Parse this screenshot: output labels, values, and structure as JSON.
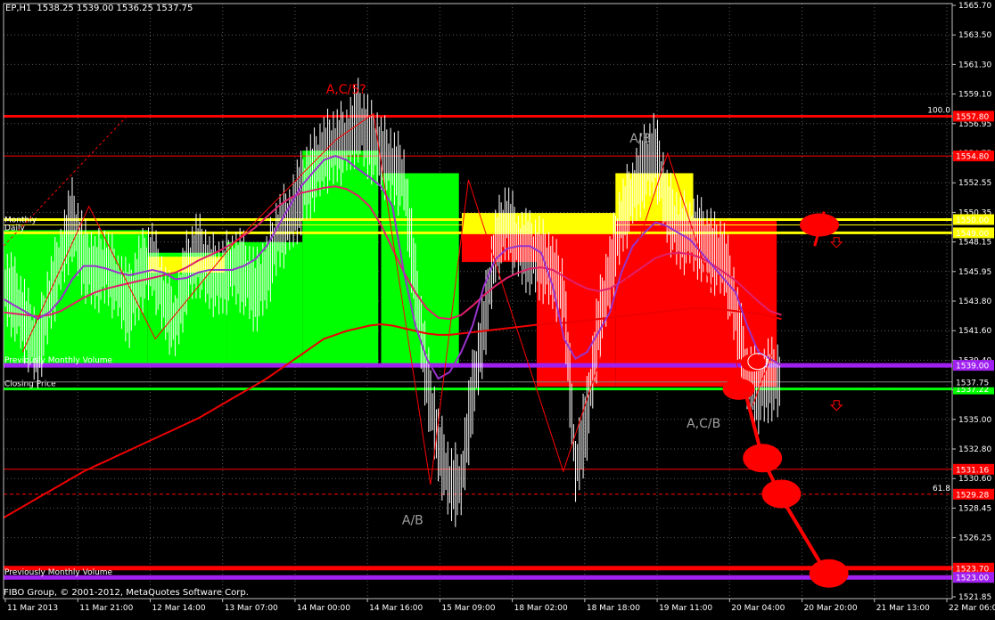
{
  "header": {
    "symbol": "EP,H1",
    "ohlc": "1538.25 1539.00 1536.25 1537.75"
  },
  "footer": {
    "copyright": "FIBO Group, © 2001-2012, MetaQuotes Software Corp."
  },
  "colors": {
    "background": "#000000",
    "frame": "#c0c0c0",
    "grid": "#c8c8c8",
    "green_box": "#00ff00",
    "red_box": "#ff0000",
    "yellow_box": "#ffff00",
    "ma_fast": "#9933cc",
    "ma_mid": "#e0206a",
    "ma_slow": "#ee0000",
    "pattern": "#ff0000"
  },
  "chart_data": {
    "type": "candlestick",
    "y_ticks": [
      "1565.70",
      "1563.50",
      "1561.30",
      "1559.10",
      "1556.95",
      "1554.75",
      "1552.55",
      "1550.35",
      "1548.15",
      "1545.95",
      "1543.80",
      "1541.60",
      "1539.40",
      "1537.20",
      "1535.00",
      "1532.80",
      "1530.60",
      "1528.45",
      "1526.25",
      "1524.05",
      "1521.85"
    ],
    "x_ticks": [
      "11 Mar 2013",
      "11 Mar 21:00",
      "12 Mar 14:00",
      "13 Mar 07:00",
      "14 Mar 00:00",
      "14 Mar 16:00",
      "15 Mar 09:00",
      "18 Mar 02:00",
      "18 Mar 18:00",
      "19 Mar 11:00",
      "20 Mar 04:00",
      "20 Mar 20:00",
      "21 Mar 13:00",
      "22 Mar 06:00"
    ],
    "ylim": [
      1521.4,
      1566.3
    ],
    "grid": true,
    "levels": [
      {
        "name": "level-top",
        "price": 1557.8,
        "color": "#ff0000",
        "width": 3,
        "tag": "1557.80",
        "right_label": "100.0"
      },
      {
        "name": "level-1554",
        "price": 1554.8,
        "color": "#ff0000",
        "width": 1,
        "tag": "1554.80"
      },
      {
        "name": "level-1550",
        "price": 1550.0,
        "color": "#ffff00",
        "width": 3,
        "tag": "1550.00"
      },
      {
        "name": "level-monthly",
        "price": 1549.6,
        "color": "#ffff00",
        "width": 1,
        "tag": "",
        "left_label": "Monthly"
      },
      {
        "name": "level-daily",
        "price": 1549.0,
        "color": "#ffff00",
        "width": 3,
        "tag": "1549.00",
        "left_label": "Daily"
      },
      {
        "name": "level-prev-volume",
        "price": 1539.0,
        "color": "#a020f0",
        "width": 5,
        "tag": "1539.00",
        "left_label": "Previously Monthly Volume"
      },
      {
        "name": "level-close",
        "price": 1537.22,
        "color": "#00ff00",
        "width": 3,
        "tag": "1537.22",
        "left_label": "Closing Price"
      },
      {
        "name": "level-1531",
        "price": 1531.16,
        "color": "#ff0000",
        "width": 1,
        "tag": "1531.16"
      },
      {
        "name": "level-1529",
        "price": 1529.28,
        "color": "#ff0000",
        "width": 1,
        "tag": "1529.28",
        "right_label": "61.8",
        "dashed": true
      },
      {
        "name": "level-1523-red",
        "price": 1523.7,
        "color": "#ff0000",
        "width": 5,
        "tag": "1523.70"
      },
      {
        "name": "level-1523-purple",
        "price": 1523.0,
        "color": "#a020f0",
        "width": 5,
        "tag": "1523.00",
        "left_label": "Previously Monthly Volume"
      }
    ],
    "current_price": "1537.75",
    "boxes": [
      {
        "color": "#00ff00",
        "x0": 0,
        "x1": 0.152,
        "y0": 1549.2,
        "y1": 1539.0
      },
      {
        "color": "#00ff00",
        "x0": 0.152,
        "x1": 0.235,
        "y0": 1547.5,
        "y1": 1539.0
      },
      {
        "color": "#00ff00",
        "x0": 0.235,
        "x1": 0.315,
        "y0": 1548.3,
        "y1": 1539.0
      },
      {
        "color": "#00ff00",
        "x0": 0.315,
        "x1": 0.395,
        "y0": 1555.2,
        "y1": 1539.0
      },
      {
        "color": "#00ff00",
        "x0": 0.398,
        "x1": 0.48,
        "y0": 1553.5,
        "y1": 1539.0
      },
      {
        "color": "#ffff00",
        "x0": 0.152,
        "x1": 0.233,
        "y0": 1547.2,
        "y1": 1546.0
      },
      {
        "color": "#ffff00",
        "x0": 0.483,
        "x1": 0.562,
        "y0": 1550.5,
        "y1": 1549.0
      },
      {
        "color": "#ff0000",
        "x0": 0.483,
        "x1": 0.562,
        "y0": 1549.0,
        "y1": 1546.8
      },
      {
        "color": "#ffff00",
        "x0": 0.562,
        "x1": 0.645,
        "y0": 1550.5,
        "y1": 1549.0
      },
      {
        "color": "#ff0000",
        "x0": 0.562,
        "x1": 0.645,
        "y0": 1549.0,
        "y1": 1537.4
      },
      {
        "color": "#ff0000",
        "x0": 0.645,
        "x1": 0.727,
        "y0": 1550.0,
        "y1": 1537.4
      },
      {
        "color": "#ffff00",
        "x0": 0.645,
        "x1": 0.727,
        "y0": 1553.5,
        "y1": 1550.0
      },
      {
        "color": "#ff0000",
        "x0": 0.727,
        "x1": 0.815,
        "y0": 1550.0,
        "y1": 1537.4
      }
    ],
    "closes": [
      1545,
      1544,
      1542,
      1540,
      1544,
      1547,
      1550,
      1547,
      1546,
      1546.5,
      1545,
      1543.5,
      1546,
      1547,
      1544,
      1542,
      1546,
      1547.5,
      1546,
      1545.5,
      1546.5,
      1546,
      1544.5,
      1546,
      1549,
      1550,
      1552,
      1553.5,
      1555,
      1555.5,
      1556,
      1557.5,
      1556,
      1555,
      1554,
      1553,
      1545,
      1538,
      1533,
      1530,
      1530,
      1537,
      1542,
      1548,
      1550,
      1548,
      1547.5,
      1547,
      1546,
      1544,
      1531,
      1535,
      1542,
      1546,
      1550,
      1552,
      1554,
      1555,
      1551,
      1549,
      1549,
      1548.5,
      1547.5,
      1547,
      1543,
      1538,
      1537,
      1538,
      1537.75
    ],
    "ma_fast": [
      1544,
      1543.5,
      1543,
      1542.5,
      1543,
      1544,
      1545.5,
      1546.5,
      1546.5,
      1546.3,
      1546,
      1545.8,
      1546,
      1546.2,
      1546,
      1545.5,
      1545.6,
      1546,
      1546.2,
      1546.2,
      1546.2,
      1546.5,
      1547,
      1548,
      1549.5,
      1551,
      1552.5,
      1553.5,
      1554.5,
      1554.8,
      1554.5,
      1553.8,
      1553.2,
      1552.5,
      1551,
      1546,
      1542,
      1539.5,
      1538,
      1538.5,
      1540,
      1542,
      1545,
      1547,
      1547.8,
      1548,
      1548,
      1547.5,
      1545,
      1541,
      1539.5,
      1540,
      1541.5,
      1543,
      1546,
      1548,
      1549,
      1549.8,
      1549.5,
      1549,
      1548.5,
      1547.5,
      1546.5,
      1545.5,
      1544.5,
      1542,
      1540,
      1539.5,
      1539
    ],
    "ma_mid": [
      1543,
      1542.9,
      1542.8,
      1542.7,
      1542.8,
      1543.1,
      1543.6,
      1544.1,
      1544.5,
      1544.8,
      1545,
      1545.2,
      1545.4,
      1545.6,
      1545.8,
      1546,
      1546.4,
      1546.9,
      1547.3,
      1547.7,
      1548.2,
      1548.8,
      1549.4,
      1550.2,
      1551,
      1551.6,
      1552,
      1552.2,
      1552.4,
      1552.5,
      1552.3,
      1551.8,
      1551,
      1549.6,
      1547.8,
      1546,
      1544.5,
      1543.3,
      1542.6,
      1542.5,
      1542.8,
      1543.5,
      1544.3,
      1545,
      1545.6,
      1546,
      1546.3,
      1546.4,
      1546.2,
      1545.7,
      1545.2,
      1544.8,
      1544.6,
      1544.8,
      1545.3,
      1545.9,
      1546.5,
      1547.1,
      1547.4,
      1547.5,
      1547.4,
      1547.1,
      1546.6,
      1546,
      1545.4,
      1544.6,
      1543.8,
      1543.1,
      1542.8
    ],
    "ma_slow": [
      1527.5,
      1528,
      1528.5,
      1529,
      1529.5,
      1530,
      1530.5,
      1531,
      1531.4,
      1531.8,
      1532.2,
      1532.6,
      1533,
      1533.4,
      1533.8,
      1534.2,
      1534.6,
      1535,
      1535.5,
      1536,
      1536.5,
      1537,
      1537.5,
      1538,
      1538.6,
      1539.2,
      1539.8,
      1540.4,
      1541,
      1541.3,
      1541.6,
      1541.8,
      1542,
      1542.1,
      1542,
      1541.8,
      1541.6,
      1541.4,
      1541.3,
      1541.3,
      1541.4,
      1541.5,
      1541.6,
      1541.7,
      1541.8,
      1541.9,
      1542,
      1542.1,
      1542.2,
      1542.2,
      1542.3,
      1542.4,
      1542.5,
      1542.6,
      1542.7,
      1542.8,
      1542.9,
      1543,
      1543.1,
      1543.2,
      1543.3,
      1543.3,
      1543.3,
      1543.2,
      1543.1,
      1543,
      1542.9,
      1542.7,
      1542.5
    ],
    "pattern_lines": [
      [
        [
          0.02,
          1540
        ],
        [
          0.09,
          1551
        ],
        [
          0.16,
          1541
        ],
        [
          0.24,
          1548
        ],
        [
          0.35,
          1556
        ],
        [
          0.39,
          1558
        ],
        [
          0.45,
          1530
        ],
        [
          0.49,
          1553
        ],
        [
          0.59,
          1531
        ],
        [
          0.7,
          1555
        ],
        [
          0.78,
          1537.5
        ]
      ],
      [
        [
          0.79,
          1536
        ],
        [
          0.8,
          1538
        ],
        [
          0.81,
          1539.8
        ]
      ]
    ],
    "guide_dash": [
      [
        0.0,
        1548
      ],
      [
        0.13,
        1557.8
      ]
    ],
    "projection": [
      [
        0.78,
        1537.5
      ],
      [
        0.8,
        1532
      ],
      [
        0.82,
        1529
      ],
      [
        0.87,
        1523
      ]
    ],
    "projection_markers": [
      {
        "x": 0.8,
        "price": 1532,
        "rx": 22,
        "ry": 16
      },
      {
        "x": 0.82,
        "price": 1529.3,
        "rx": 22,
        "ry": 16
      },
      {
        "x": 0.87,
        "price": 1523.3,
        "rx": 22,
        "ry": 16
      },
      {
        "x": 0.775,
        "price": 1537.2,
        "rx": 18,
        "ry": 12
      },
      {
        "x": 0.79,
        "price": 1539.2,
        "rx": 14,
        "ry": 10
      },
      {
        "x": 0.86,
        "price": 1549.6,
        "rx": 22,
        "ry": 13
      }
    ],
    "arrows": [
      {
        "x": 0.878,
        "price": 1548.3
      },
      {
        "x": 0.878,
        "price": 1536.0
      }
    ],
    "annotations": [
      {
        "text": "A,C/5?",
        "x": 0.34,
        "price": 1559.5,
        "color": "#ff0000"
      },
      {
        "text": "A/B",
        "x": 0.66,
        "price": 1555.8,
        "color": "#a0a0a0"
      },
      {
        "text": "A/B",
        "x": 0.42,
        "price": 1527.0,
        "color": "#a0a0a0"
      },
      {
        "text": "A,C/B",
        "x": 0.72,
        "price": 1534.3,
        "color": "#a0a0a0"
      }
    ]
  }
}
